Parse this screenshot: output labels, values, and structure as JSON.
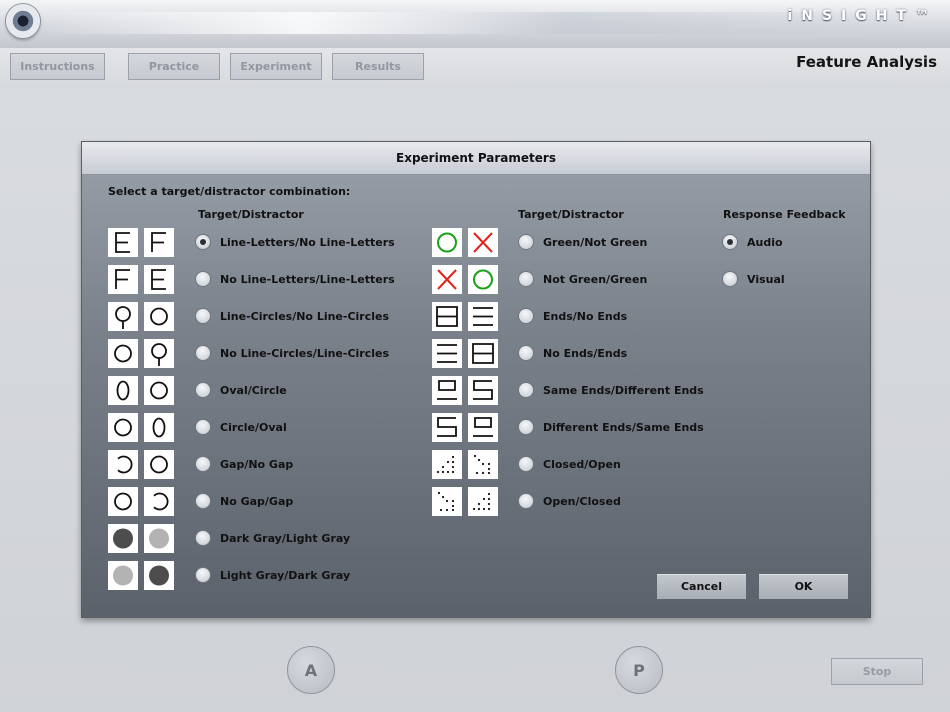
{
  "app": {
    "logo": "iNSIGHT™",
    "page_title": "Feature Analysis"
  },
  "nav": [
    {
      "label": "Instructions"
    },
    {
      "label": "Practice"
    },
    {
      "label": "Experiment"
    },
    {
      "label": "Results"
    }
  ],
  "dialog": {
    "title": "Experiment Parameters",
    "instruction": "Select a target/distractor combination:",
    "col1_header": "Target/Distractor",
    "col2_header": "Target/Distractor",
    "col3_header": "Response Feedback",
    "col1_options": [
      {
        "label": "Line-Letters/No Line-Letters",
        "selected": true,
        "icons": [
          "letter-E",
          "letter-F"
        ]
      },
      {
        "label": "No Line-Letters/Line-Letters",
        "selected": false,
        "icons": [
          "letter-F",
          "letter-E"
        ]
      },
      {
        "label": "Line-Circles/No Line-Circles",
        "selected": false,
        "icons": [
          "line-circle",
          "circle"
        ]
      },
      {
        "label": "No Line-Circles/Line-Circles",
        "selected": false,
        "icons": [
          "circle",
          "line-circle"
        ]
      },
      {
        "label": "Oval/Circle",
        "selected": false,
        "icons": [
          "oval",
          "circle"
        ]
      },
      {
        "label": "Circle/Oval",
        "selected": false,
        "icons": [
          "circle",
          "oval"
        ]
      },
      {
        "label": "Gap/No Gap",
        "selected": false,
        "icons": [
          "gap-circle",
          "circle"
        ]
      },
      {
        "label": "No Gap/Gap",
        "selected": false,
        "icons": [
          "circle",
          "gap-circle"
        ]
      },
      {
        "label": "Dark Gray/Light Gray",
        "selected": false,
        "icons": [
          "dark-dot",
          "light-dot"
        ]
      },
      {
        "label": "Light Gray/Dark Gray",
        "selected": false,
        "icons": [
          "light-dot",
          "dark-dot"
        ]
      }
    ],
    "col2_options": [
      {
        "label": "Green/Not Green",
        "selected": false,
        "icons": [
          "green-circle",
          "red-x"
        ]
      },
      {
        "label": "Not Green/Green",
        "selected": false,
        "icons": [
          "red-x",
          "green-circle"
        ]
      },
      {
        "label": "Ends/No Ends",
        "selected": false,
        "icons": [
          "ends",
          "no-ends"
        ]
      },
      {
        "label": "No Ends/Ends",
        "selected": false,
        "icons": [
          "no-ends",
          "ends"
        ]
      },
      {
        "label": "Same Ends/Different Ends",
        "selected": false,
        "icons": [
          "same-ends",
          "diff-ends"
        ]
      },
      {
        "label": "Different Ends/Same Ends",
        "selected": false,
        "icons": [
          "diff-ends",
          "same-ends"
        ]
      },
      {
        "label": "Closed/Open",
        "selected": false,
        "icons": [
          "dots-closed",
          "dots-open"
        ]
      },
      {
        "label": "Open/Closed",
        "selected": false,
        "icons": [
          "dots-open",
          "dots-closed"
        ]
      }
    ],
    "feedback_options": [
      {
        "label": "Audio",
        "selected": true
      },
      {
        "label": "Visual",
        "selected": false
      }
    ],
    "cancel_label": "Cancel",
    "ok_label": "OK"
  },
  "bottom": {
    "a_label": "A",
    "p_label": "P",
    "stop_label": "Stop"
  },
  "colors": {
    "green": "#1aa31a",
    "red": "#e3231c",
    "dark_gray": "#4d4d4d",
    "light_gray": "#b3b3b3"
  }
}
